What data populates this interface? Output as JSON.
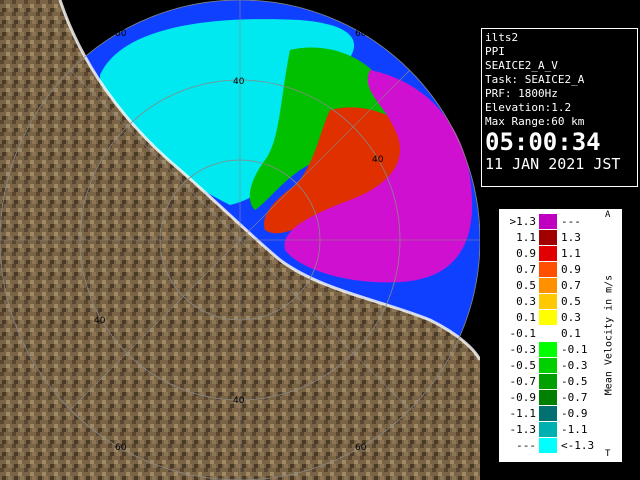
{
  "info": {
    "station": "ilts2",
    "product": "PPI",
    "dataset": "SEAICE2_A_V",
    "task": "Task: SEAICE2_A",
    "prf": "PRF: 1800Hz",
    "elevation": "Elevation:1.2",
    "max_range": "Max Range:60 km",
    "time": "05:00:34",
    "date": "11 JAN 2021 JST"
  },
  "range_labels": [
    "60",
    "40",
    "40",
    "40",
    "60",
    "40",
    "60",
    "60"
  ],
  "legend": {
    "title": "Mean Velocity in m/s",
    "top_mark": "A",
    "bottom_mark": "T",
    "rows": [
      {
        "left": ">1.3",
        "right": "---",
        "color": "#c000c0"
      },
      {
        "left": "1.1",
        "right": "1.3",
        "color": "#a00000"
      },
      {
        "left": "0.9",
        "right": "1.1",
        "color": "#e00000"
      },
      {
        "left": "0.7",
        "right": "0.9",
        "color": "#ff5000"
      },
      {
        "left": "0.5",
        "right": "0.7",
        "color": "#ff9000"
      },
      {
        "left": "0.3",
        "right": "0.5",
        "color": "#ffc800"
      },
      {
        "left": "0.1",
        "right": "0.3",
        "color": "#ffff00"
      },
      {
        "left": "-0.1",
        "right": "0.1",
        "color": "#ffffff"
      },
      {
        "left": "-0.3",
        "right": "-0.1",
        "color": "#00ff00"
      },
      {
        "left": "-0.5",
        "right": "-0.3",
        "color": "#00d000"
      },
      {
        "left": "-0.7",
        "right": "-0.5",
        "color": "#00a000"
      },
      {
        "left": "-0.9",
        "right": "-0.7",
        "color": "#008000"
      },
      {
        "left": "-1.1",
        "right": "-0.9",
        "color": "#007070"
      },
      {
        "left": "-1.3",
        "right": "-1.1",
        "color": "#00b0b0"
      },
      {
        "left": "---",
        "right": "<-1.3",
        "color": "#00ffff"
      }
    ]
  },
  "colors": {
    "sea": "#1040ff",
    "land": "#7a6446",
    "cyan_echo": "#00e8f0",
    "magenta_echo": "#d010d0"
  }
}
